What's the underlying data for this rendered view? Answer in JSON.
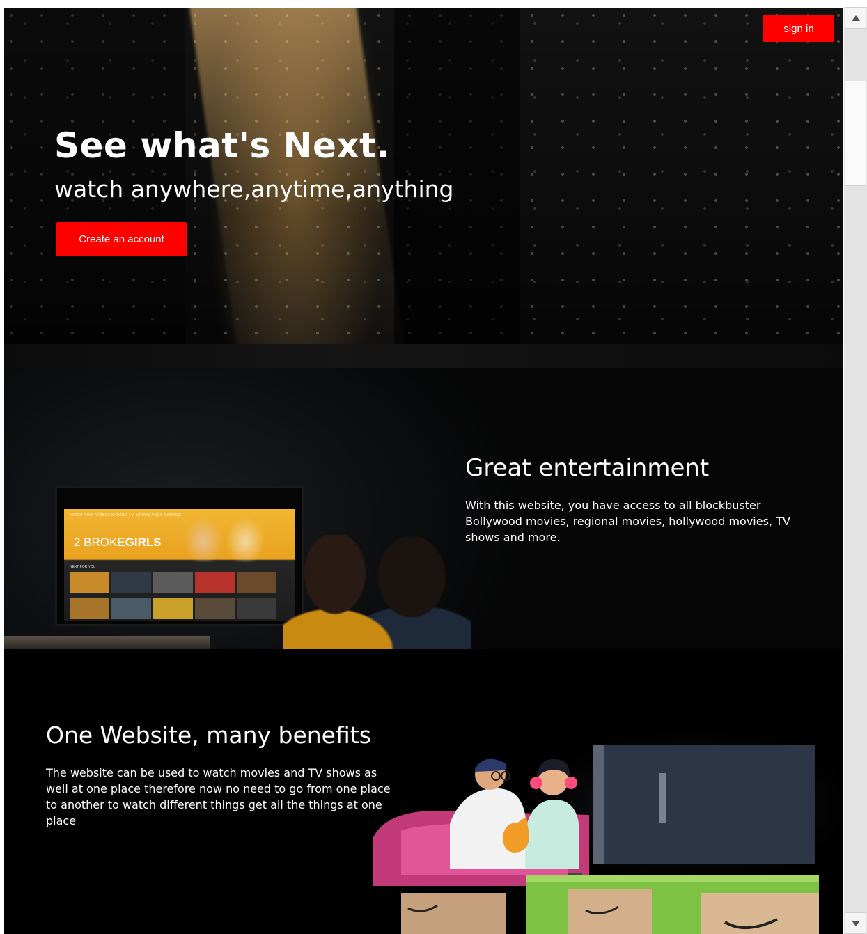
{
  "header": {
    "sign_in_label": "sign in"
  },
  "hero": {
    "title": "See what's Next.",
    "subtitle": "watch anywhere,anytime,anything",
    "cta_label": "Create an account"
  },
  "feature_entertainment": {
    "heading": "Great entertainment",
    "body": "With this website, you have access to all blockbuster Bollywood movies, regional movies, hollywood movies, TV shows and more.",
    "tv_nav": "Home   Your Videos   Movies   TV Shows   Apps   Settings",
    "tv_show_light": "2 BROKE",
    "tv_show_bold": "GIRLS",
    "tv_row_label": "NEXT FOR YOU"
  },
  "feature_benefits": {
    "heading": "One Website, many benefits",
    "body": "The website can be used to watch movies and TV shows as well at one place therefore now no need to go from one place to another to watch different things get all the things at one place"
  },
  "colors": {
    "accent": "#ff0000",
    "background": "#000000",
    "text": "#ffffff"
  },
  "icons": {
    "scroll_up": "triangle-up-icon",
    "scroll_down": "triangle-down-icon"
  }
}
